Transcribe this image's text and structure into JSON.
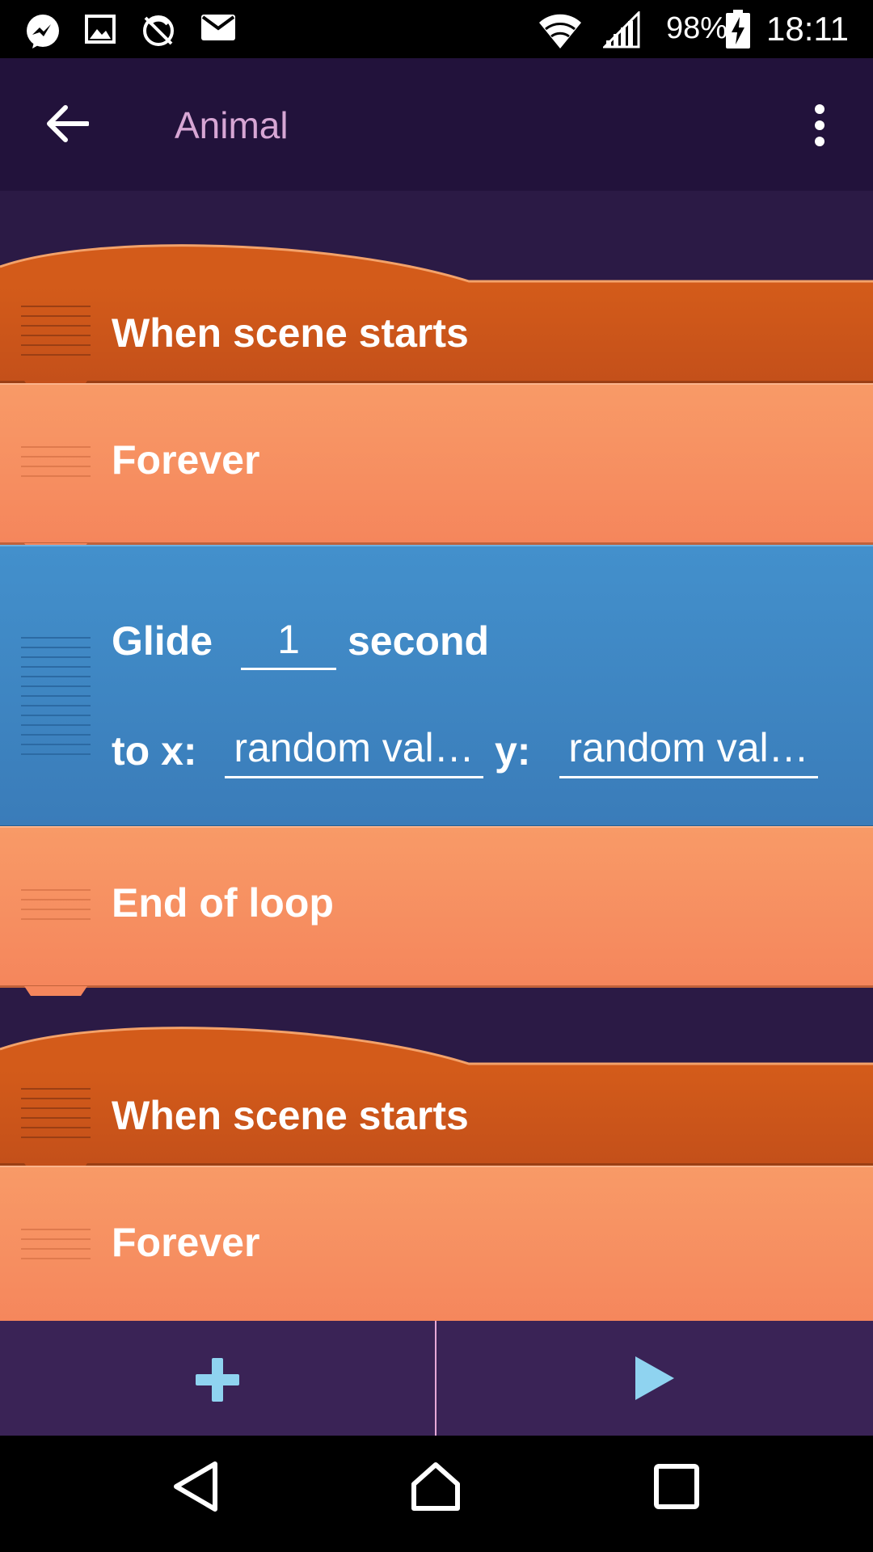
{
  "status_bar": {
    "icons": [
      "messenger-icon",
      "gallery-icon",
      "no-sync-icon",
      "mail-icon",
      "wifi-icon",
      "signal-icon",
      "battery-charging-icon"
    ],
    "battery": "98%",
    "time": "18:11"
  },
  "app_bar": {
    "title": "Animal",
    "back_icon": "arrow-back-icon",
    "more_icon": "more-vert-icon"
  },
  "script_1": {
    "event_label": "When scene starts",
    "loop_label": "Forever",
    "glide": {
      "label": "Glide",
      "seconds_value": "1",
      "seconds_unit": "second",
      "to_x_label": "to x:",
      "x_value": "random val…",
      "y_label": "y:",
      "y_value": "random val…"
    },
    "end_loop_label": "End of loop"
  },
  "script_2": {
    "event_label": "When scene starts",
    "loop_label": "Forever"
  },
  "bottom_bar": {
    "add_icon": "plus-icon",
    "play_icon": "play-icon"
  },
  "nav_bar": {
    "icons": [
      "back-triangle-icon",
      "home-icon",
      "recents-square-icon"
    ]
  },
  "colors": {
    "event_brick": "#d35b1a",
    "control_brick": "#f89a67",
    "motion_brick": "#4390cc",
    "background": "#2b1a45",
    "app_bar": "#22123b",
    "title": "#d7a6d4",
    "bottom_icons": "#8fd3f0"
  }
}
